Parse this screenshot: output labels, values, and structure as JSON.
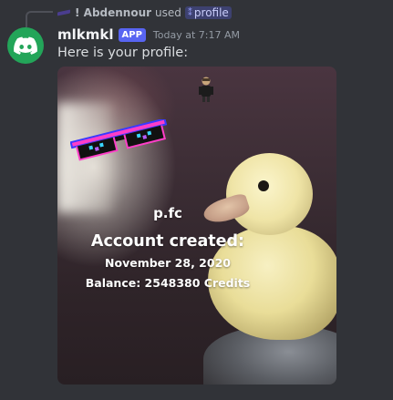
{
  "reply": {
    "user": "! Abdennour",
    "used": "used",
    "command": "profile"
  },
  "message": {
    "author": "mlkmkl",
    "badge": "APP",
    "timestamp": "Today at 7:17 AM",
    "text": "Here is your profile:"
  },
  "profile_card": {
    "name": "p.fc",
    "created_label": "Account created:",
    "created_date": "November 28, 2020",
    "balance": "Balance: 2548380 Credits"
  },
  "colors": {
    "background": "#313338",
    "avatar": "#23a559",
    "app_badge": "#5865f2"
  },
  "icons": [
    "reply-avatar-icon",
    "slash-command-icon",
    "discord-logo-icon",
    "pixel-sunglasses-icon",
    "figure-icon"
  ]
}
